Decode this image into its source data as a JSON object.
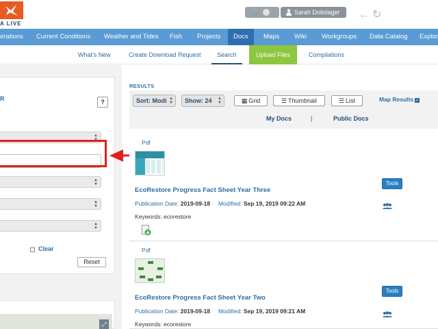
{
  "header": {
    "logo_text": "A LIVE",
    "user_name": "Sarah Dolislager",
    "icons": [
      "logo-bird-icon",
      "cart-icon",
      "user-icon",
      "back-arrow-icon",
      "refresh-icon"
    ]
  },
  "mainnav": {
    "items": [
      {
        "label": "erations"
      },
      {
        "label": "Current Conditions"
      },
      {
        "label": "Weather and Tides"
      },
      {
        "label": "Fish"
      },
      {
        "label": "Projects"
      },
      {
        "label": "Docs"
      },
      {
        "label": "Maps"
      },
      {
        "label": "Wiki"
      },
      {
        "label": "Workgroups"
      },
      {
        "label": "Data Catalog"
      },
      {
        "label": "Explor"
      }
    ],
    "active": "Docs"
  },
  "subnav": {
    "items": [
      {
        "label": "What's New"
      },
      {
        "label": "Create Download Request"
      },
      {
        "label": "Search"
      },
      {
        "label": "Upload Files"
      },
      {
        "label": "Compilations"
      }
    ]
  },
  "filter": {
    "title": "R",
    "help": "?",
    "keyword_value": "",
    "clear_label": "Clear",
    "reset_label": "Reset",
    "map_expand": "⤢"
  },
  "results": {
    "label": "RESULTS",
    "sort_label": "Sort: Modi",
    "show_label": "Show: 24",
    "grid_label": "Grid",
    "thumbnail_label": "Thumbnail",
    "list_label": "List",
    "map_results_label": "Map Results",
    "map_results_checked": true,
    "my_docs": "My Docs",
    "separator": "|",
    "public_docs": "Public Docs",
    "docs": [
      {
        "type": "Pdf",
        "title": "EcoRestore Progress Fact Sheet Year Three",
        "pub_label": "Publication Date:",
        "pub_date": "2019-09-18",
        "mod_label": "Modified:",
        "mod_date": "Sep 19, 2019 09:22 AM",
        "keywords": "Keywords: ecorestore",
        "tools": "Tools"
      },
      {
        "type": "Pdf",
        "title": "EcoRestore Progress Fact Sheet Year Two",
        "pub_label": "Publication Date:",
        "pub_date": "2019-09-18",
        "mod_label": "Modified:",
        "mod_date": "Sep 19, 2019 09:21 AM",
        "keywords": "Keywords: ecorestore",
        "tools": "Tools"
      }
    ]
  },
  "colors": {
    "nav_blue": "#5a9bd5",
    "nav_active": "#2f6fb0",
    "upload_green": "#8dc63f",
    "link_blue": "#2e6da4",
    "highlight_red": "#e0201b",
    "logo_orange": "#e85b25"
  }
}
